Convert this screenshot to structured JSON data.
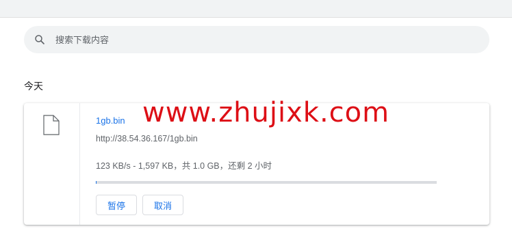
{
  "search": {
    "placeholder": "搜索下载内容",
    "value": ""
  },
  "date_header": "今天",
  "download": {
    "file_name": "1gb.bin",
    "url": "http://38.54.36.167/1gb.bin",
    "status": "123 KB/s - 1,597 KB，共 1.0 GB，还剩 2 小时",
    "progress": 0.0016,
    "pause_label": "暂停",
    "cancel_label": "取消"
  },
  "watermark": "www.zhujixk.com",
  "colors": {
    "accent": "#1a73e8",
    "watermark": "#dd0f16"
  }
}
